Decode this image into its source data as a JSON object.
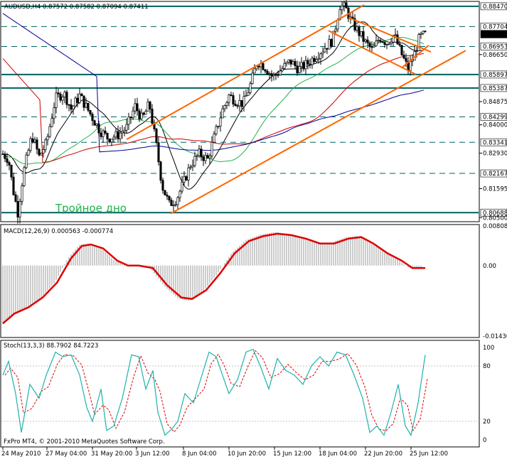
{
  "main": {
    "header": "AUDUSD,H4  0.87572 0.87582 0.87094 0.87411",
    "annotation": "Тройное дно",
    "price_ticks": [
      "0.88470",
      "0.87704",
      "0.87411",
      "0.86953",
      "0.86650",
      "0.85897",
      "0.85387",
      "0.84875",
      "0.84299",
      "0.84000",
      "0.83341",
      "0.82930",
      "0.82167",
      "0.81595",
      "0.80688",
      "0.80500"
    ],
    "boxed_levels": [
      "0.88470",
      "0.87704",
      "0.87411",
      "0.86953",
      "0.85897",
      "0.85387",
      "0.84299",
      "0.83341",
      "0.82167",
      "0.80688"
    ],
    "current_price": "0.87411",
    "y_range": [
      0.804,
      0.886
    ]
  },
  "macd": {
    "header": "MACD(12,26,9) 0.000563 -0.000774",
    "ticks": [
      "0.00808",
      "0.00",
      "-0.01436"
    ],
    "y_range": [
      -0.01436,
      0.00808
    ]
  },
  "stoch": {
    "header": "Stoch(13,3,3) 88.7902 84.7223",
    "ticks": [
      "100",
      "80",
      "20",
      "0"
    ],
    "levels": [
      80,
      20
    ],
    "y_range": [
      0,
      100
    ]
  },
  "x_axis": {
    "labels": [
      "24 May 2010",
      "27 May 04:00",
      "31 May 20:00",
      "3 Jun 12:00",
      "8 Jun 04:00",
      "10 Jun 20:00",
      "15 Jun 12:00",
      "18 Jun 04:00",
      "22 Jun 20:00",
      "25 Jun 12:00"
    ]
  },
  "footer": "FxPro MT4, © 2001-2010 MetaQuotes Software Corp.",
  "colors": {
    "background": "#ffffff",
    "grid": "#000000",
    "level_line": "#006060",
    "channel": "#ff6600",
    "ma_fast": "#000000",
    "ma_mid": "#21b24a",
    "ma_slow": "#cc0000",
    "ma_long": "#000099",
    "annotation": "#21b24a",
    "macd_signal": "#dd0000",
    "macd_hist": "#999999",
    "stoch_main": "#20b2aa",
    "stoch_signal": "#dd0000"
  },
  "chart_data": {
    "type": "line",
    "title": "AUDUSD,H4",
    "x": [
      "24 May 2010",
      "27 May 04:00",
      "31 May 20:00",
      "3 Jun 12:00",
      "8 Jun 04:00",
      "10 Jun 20:00",
      "15 Jun 12:00",
      "18 Jun 04:00",
      "22 Jun 20:00",
      "25 Jun 12:00"
    ],
    "series": [
      {
        "name": "AUDUSD H4 close (approx.)",
        "values": [
          0.826,
          0.852,
          0.834,
          0.844,
          0.811,
          0.846,
          0.866,
          0.881,
          0.868,
          0.8741
        ]
      }
    ],
    "ylim": [
      0.805,
      0.8847
    ]
  }
}
